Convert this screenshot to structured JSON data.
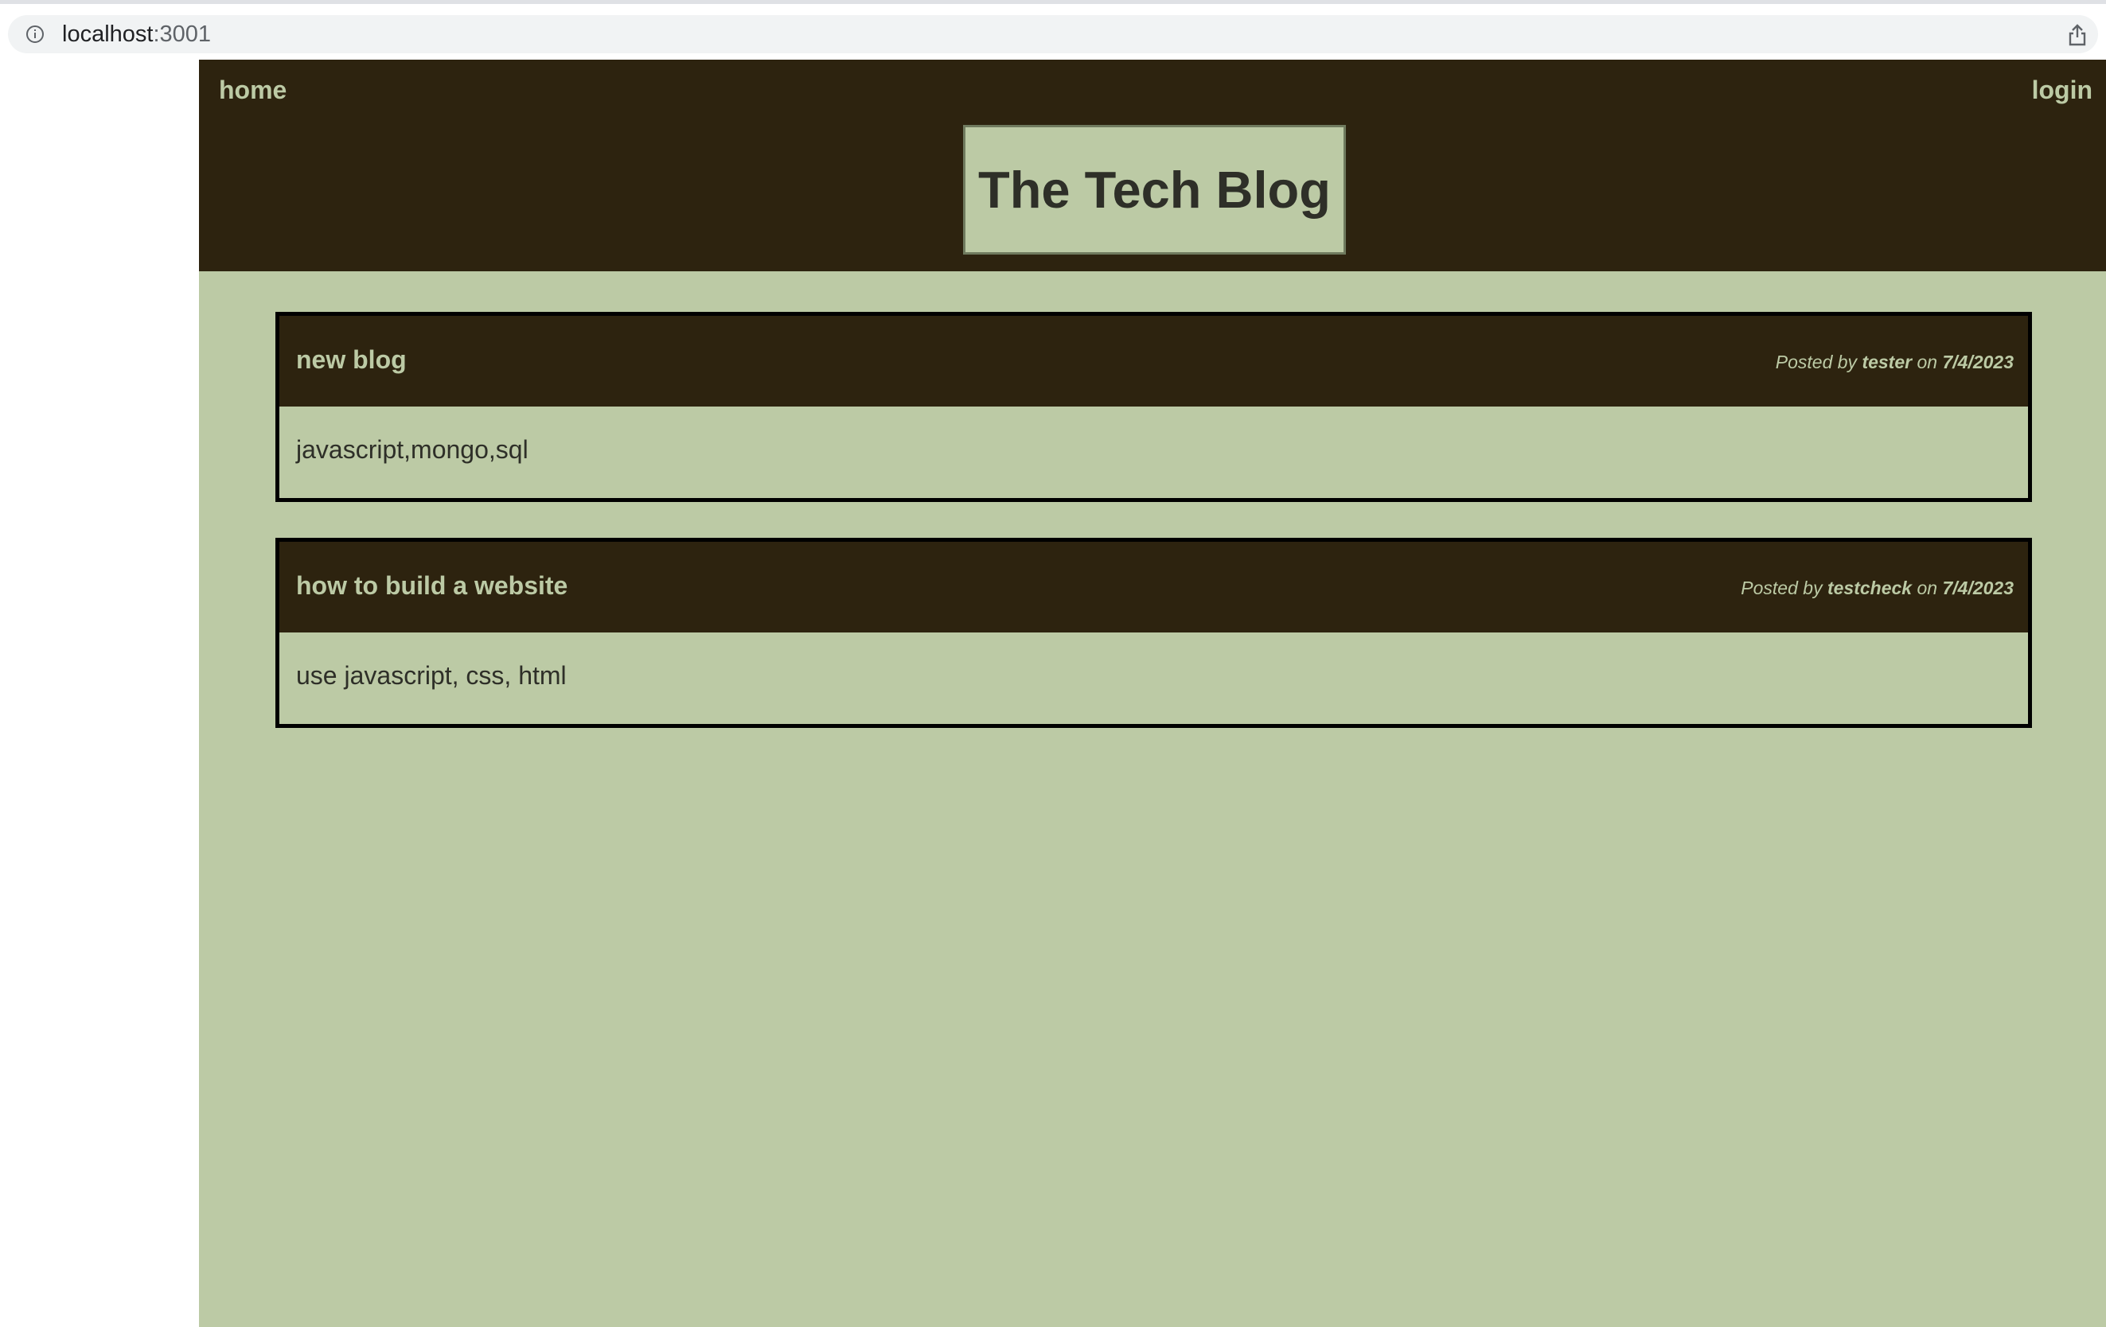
{
  "browser": {
    "url_host": "localhost",
    "url_port": ":3001"
  },
  "nav": {
    "home": "home",
    "login": "login"
  },
  "site": {
    "title": "The Tech Blog"
  },
  "posts": [
    {
      "title": "new blog",
      "posted_by_prefix": "Posted by",
      "author": "tester",
      "on_word": "on",
      "date": "7/4/2023",
      "body": "javascript,mongo,sql"
    },
    {
      "title": "how to build a website",
      "posted_by_prefix": "Posted by",
      "author": "testcheck",
      "on_word": "on",
      "date": "7/4/2023",
      "body": "use javascript, css, html"
    }
  ],
  "colors": {
    "header_bg": "#2d230f",
    "page_bg": "#bccaa5",
    "title_text": "#2e2f28"
  }
}
